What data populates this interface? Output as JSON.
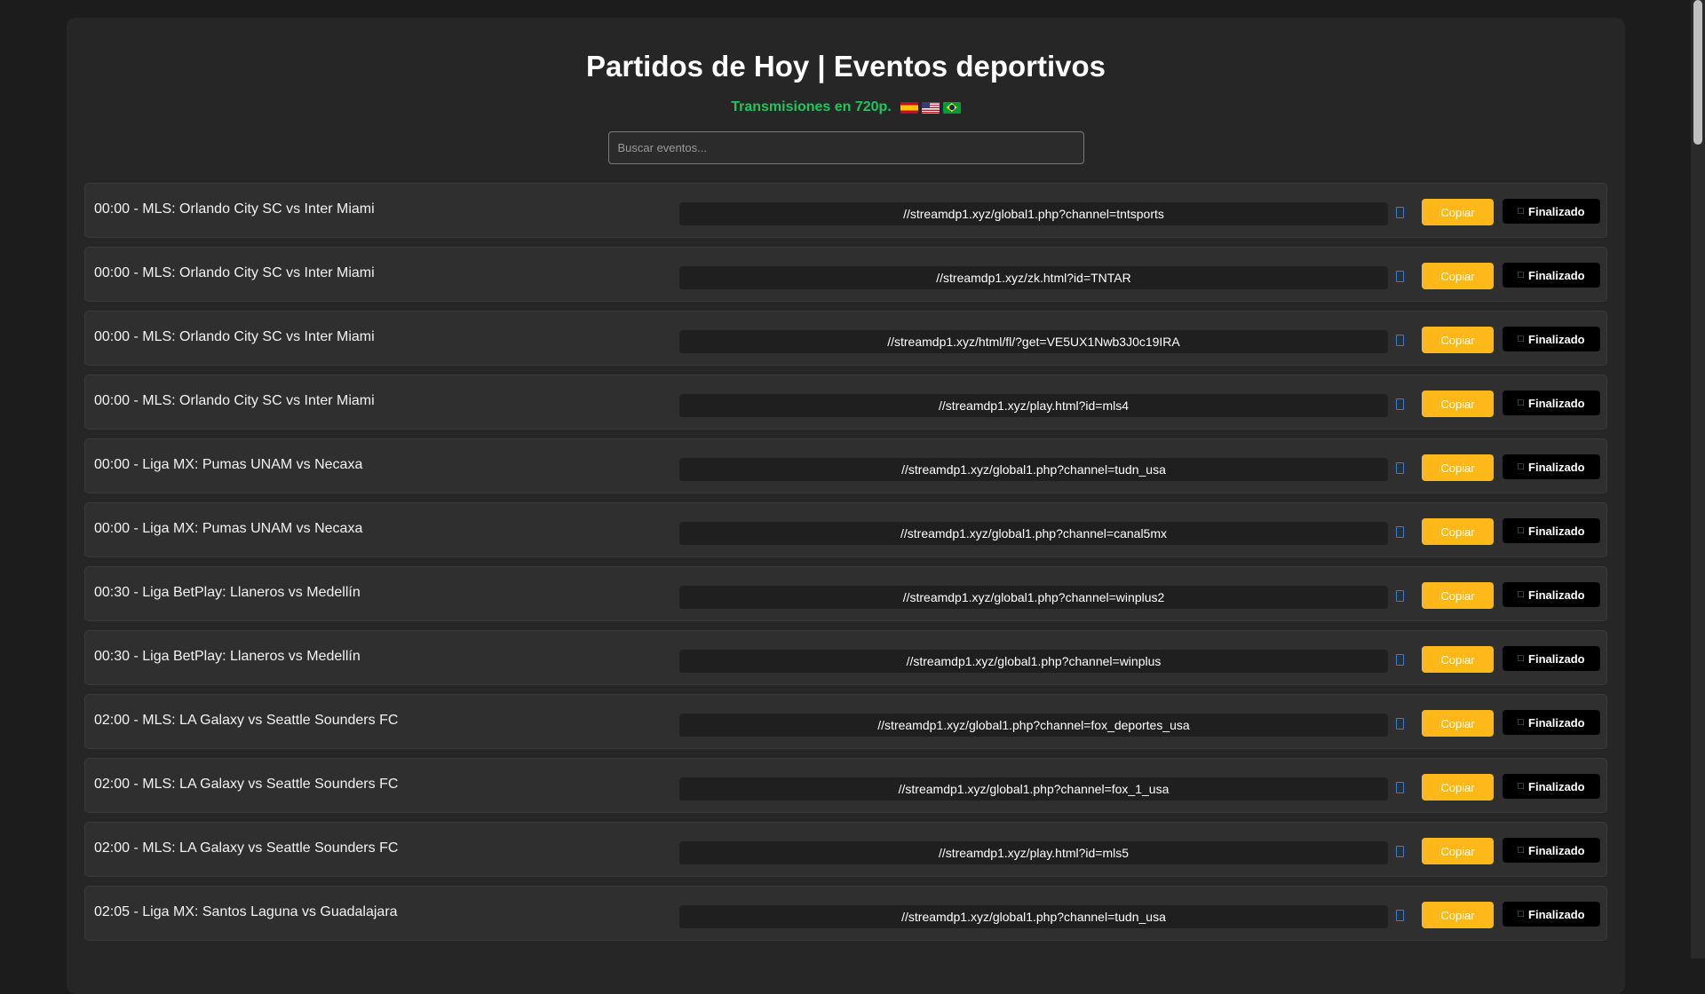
{
  "header": {
    "title": "Partidos de Hoy | Eventos deportivos",
    "subtitle": "Transmisiones en 720p.",
    "flags": [
      "flag-spain-icon",
      "flag-usa-icon",
      "flag-brazil-icon"
    ]
  },
  "search": {
    "placeholder": "Buscar eventos...",
    "value": ""
  },
  "buttons": {
    "copy_label": "Copiar",
    "status_label": "Finalizado"
  },
  "colors": {
    "accent_green": "#21c55d",
    "copy_button": "#ffb81a",
    "status_button": "#000000",
    "copy_icon": "#3a7bd5"
  },
  "events": [
    {
      "name": "00:00 - MLS: Orlando City SC vs Inter Miami",
      "link": "//streamdp1.xyz/global1.php?channel=tntsports"
    },
    {
      "name": "00:00 - MLS: Orlando City SC vs Inter Miami",
      "link": "//streamdp1.xyz/zk.html?id=TNTAR"
    },
    {
      "name": "00:00 - MLS: Orlando City SC vs Inter Miami",
      "link": "//streamdp1.xyz/html/fl/?get=VE5UX1Nwb3J0c19IRA"
    },
    {
      "name": "00:00 - MLS: Orlando City SC vs Inter Miami",
      "link": "//streamdp1.xyz/play.html?id=mls4"
    },
    {
      "name": "00:00 - Liga MX: Pumas UNAM vs Necaxa",
      "link": "//streamdp1.xyz/global1.php?channel=tudn_usa"
    },
    {
      "name": "00:00 - Liga MX: Pumas UNAM vs Necaxa",
      "link": "//streamdp1.xyz/global1.php?channel=canal5mx"
    },
    {
      "name": "00:30 - Liga BetPlay: Llaneros vs Medellín",
      "link": "//streamdp1.xyz/global1.php?channel=winplus2"
    },
    {
      "name": "00:30 - Liga BetPlay: Llaneros vs Medellín",
      "link": "//streamdp1.xyz/global1.php?channel=winplus"
    },
    {
      "name": "02:00 - MLS: LA Galaxy vs Seattle Sounders FC",
      "link": "//streamdp1.xyz/global1.php?channel=fox_deportes_usa"
    },
    {
      "name": "02:00 - MLS: LA Galaxy vs Seattle Sounders FC",
      "link": "//streamdp1.xyz/global1.php?channel=fox_1_usa"
    },
    {
      "name": "02:00 - MLS: LA Galaxy vs Seattle Sounders FC",
      "link": "//streamdp1.xyz/play.html?id=mls5"
    },
    {
      "name": "02:05 - Liga MX: Santos Laguna vs Guadalajara",
      "link": "//streamdp1.xyz/global1.php?channel=tudn_usa"
    }
  ]
}
